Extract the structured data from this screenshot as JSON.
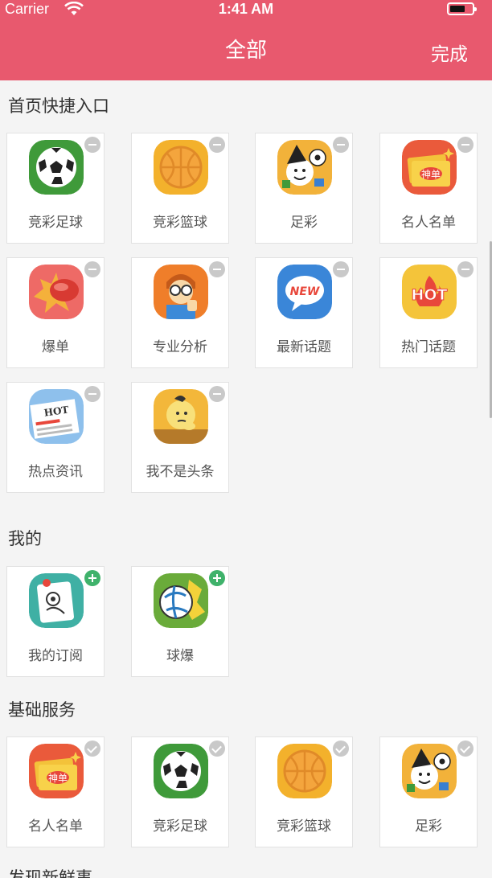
{
  "status_bar": {
    "carrier": "Carrier",
    "time": "1:41 AM"
  },
  "nav": {
    "title": "全部",
    "done_label": "完成"
  },
  "colors": {
    "brand": "#e8596e",
    "add_badge": "#3fb26b",
    "muted_badge": "#c9c9c9"
  },
  "sections": [
    {
      "title": "首页快捷入口",
      "badge": "minus",
      "items": [
        {
          "label": "竞彩足球",
          "icon": "soccer-ball-icon"
        },
        {
          "label": "竞彩篮球",
          "icon": "basketball-icon"
        },
        {
          "label": "足彩",
          "icon": "clown-soccer-icon"
        },
        {
          "label": "名人名单",
          "icon": "ticket-icon"
        },
        {
          "label": "爆单",
          "icon": "boxing-glove-icon"
        },
        {
          "label": "专业分析",
          "icon": "analyst-icon"
        },
        {
          "label": "最新话题",
          "icon": "new-bubble-icon"
        },
        {
          "label": "热门话题",
          "icon": "hot-fire-icon"
        },
        {
          "label": "热点资讯",
          "icon": "newspaper-icon"
        },
        {
          "label": "我不是头条",
          "icon": "thinking-kid-icon"
        }
      ]
    },
    {
      "title": "我的",
      "badge": "plus",
      "items": [
        {
          "label": "我的订阅",
          "icon": "pinned-note-icon"
        },
        {
          "label": "球爆",
          "icon": "exploding-ball-icon"
        }
      ]
    },
    {
      "title": "基础服务",
      "badge": "check",
      "items": [
        {
          "label": "名人名单",
          "icon": "ticket-icon"
        },
        {
          "label": "竞彩足球",
          "icon": "soccer-ball-icon"
        },
        {
          "label": "竞彩篮球",
          "icon": "basketball-icon"
        },
        {
          "label": "足彩",
          "icon": "clown-soccer-icon"
        }
      ]
    },
    {
      "title": "发现新鲜事"
    }
  ],
  "icon_text": {
    "ticket": "神单",
    "new": "NEW",
    "hot": "HOT",
    "news": "HOT"
  }
}
